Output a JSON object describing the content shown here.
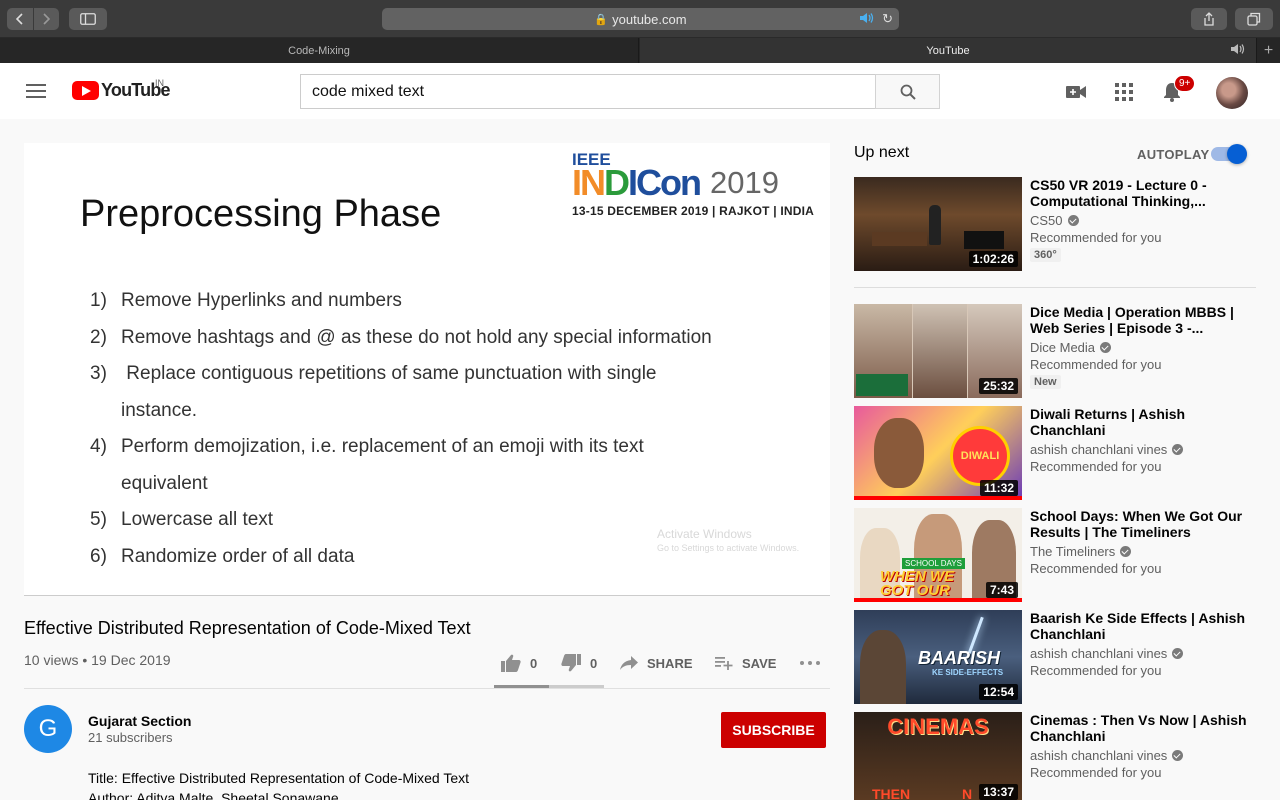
{
  "browser": {
    "url": "youtube.com",
    "tabs": [
      {
        "label": "Code-Mixing"
      },
      {
        "label": "YouTube"
      }
    ]
  },
  "header": {
    "logo_text": "YouTube",
    "logo_region": "IN",
    "search_value": "code mixed text",
    "notifications_badge": "9+"
  },
  "slide": {
    "conference_top": "IEEE",
    "conference_year": "2019",
    "conference_sub": "13-15 DECEMBER 2019 | RAJKOT | INDIA",
    "title": "Preprocessing Phase",
    "items": [
      {
        "num": "1)",
        "text": "Remove Hyperlinks and numbers"
      },
      {
        "num": "2)",
        "text": "Remove hashtags and @ as these do not hold any special information"
      },
      {
        "num": "3)",
        "text": " Replace contiguous repetitions of same punctuation with single instance."
      },
      {
        "num": "4)",
        "text": "Perform demojization, i.e. replacement of an emoji with its text equivalent"
      },
      {
        "num": "5)",
        "text": "Lowercase all text"
      },
      {
        "num": "6)",
        "text": "Randomize order of all data"
      }
    ],
    "watermark_line1": "Activate Windows",
    "watermark_line2": "Go to Settings to activate Windows."
  },
  "video": {
    "title": "Effective Distributed Representation of Code-Mixed Text",
    "meta": "10 views • 19 Dec 2019",
    "likes": "0",
    "dislikes": "0",
    "share_label": "SHARE",
    "save_label": "SAVE",
    "like_ratio": 0.5
  },
  "channel": {
    "avatar_letter": "G",
    "name": "Gujarat Section",
    "subscribers": "21 subscribers",
    "subscribe_label": "SUBSCRIBE",
    "avatar_color": "#1e88e5"
  },
  "description": {
    "line1": "Title: Effective Distributed Representation of Code-Mixed Text",
    "line2": "Author: Aditya Malte, Sheetal Sonawane"
  },
  "upnext": {
    "title": "Up next",
    "autoplay_label": "AUTOPLAY",
    "autoplay_on": true,
    "items": [
      {
        "title": "CS50 VR 2019 - Lecture 0 - Computational Thinking,...",
        "channel": "CS50",
        "rec": "Recommended for you",
        "badge": "360°",
        "duration": "1:02:26"
      },
      {
        "title": "Dice Media | Operation MBBS | Web Series | Episode 3 -...",
        "channel": "Dice Media",
        "rec": "Recommended for you",
        "badge": "New",
        "duration": "25:32"
      },
      {
        "title": "Diwali Returns | Ashish Chanchlani",
        "channel": "ashish chanchlani vines",
        "rec": "Recommended for you",
        "duration": "11:32",
        "thumb_text": "DIWALI"
      },
      {
        "title": "School Days: When We Got Our Results | The Timeliners",
        "channel": "The Timeliners",
        "rec": "Recommended for you",
        "duration": "7:43",
        "thumb_text": "WHEN WE GOT OUR RESULT",
        "thumb_tag": "SCHOOL DAYS"
      },
      {
        "title": "Baarish Ke Side Effects | Ashish Chanchlani",
        "channel": "ashish chanchlani vines",
        "rec": "Recommended for you",
        "duration": "12:54",
        "thumb_text": "BAARISH",
        "thumb_sub": "KE SIDE-EFFECTS"
      },
      {
        "title": "Cinemas : Then Vs Now | Ashish Chanchlani",
        "channel": "ashish chanchlani vines",
        "rec": "Recommended for you",
        "duration": "13:37",
        "thumb_text": "CINEMAS",
        "thumb_then": "THEN",
        "thumb_now": "N"
      }
    ]
  },
  "colors": {
    "brand_red": "#ff0000",
    "subscribe_red": "#cc0000",
    "toggle_blue": "#065fd4"
  }
}
